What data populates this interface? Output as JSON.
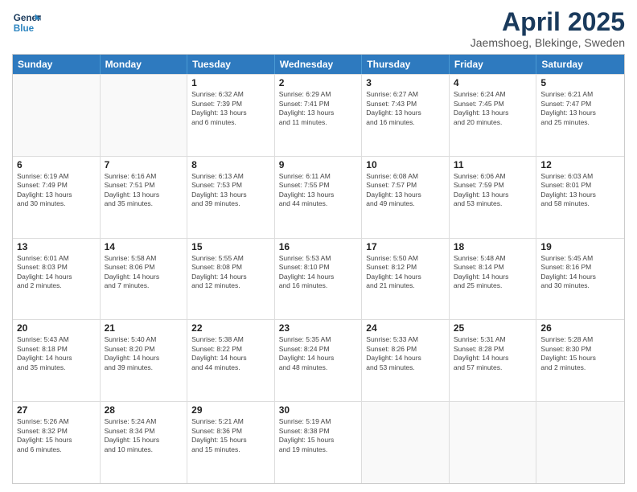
{
  "header": {
    "logo_line1": "General",
    "logo_line2": "Blue",
    "main_title": "April 2025",
    "subtitle": "Jaemshoeg, Blekinge, Sweden"
  },
  "calendar": {
    "days_of_week": [
      "Sunday",
      "Monday",
      "Tuesday",
      "Wednesday",
      "Thursday",
      "Friday",
      "Saturday"
    ],
    "rows": [
      [
        {
          "day": "",
          "empty": true,
          "lines": []
        },
        {
          "day": "",
          "empty": true,
          "lines": []
        },
        {
          "day": "1",
          "empty": false,
          "lines": [
            "Sunrise: 6:32 AM",
            "Sunset: 7:39 PM",
            "Daylight: 13 hours",
            "and 6 minutes."
          ]
        },
        {
          "day": "2",
          "empty": false,
          "lines": [
            "Sunrise: 6:29 AM",
            "Sunset: 7:41 PM",
            "Daylight: 13 hours",
            "and 11 minutes."
          ]
        },
        {
          "day": "3",
          "empty": false,
          "lines": [
            "Sunrise: 6:27 AM",
            "Sunset: 7:43 PM",
            "Daylight: 13 hours",
            "and 16 minutes."
          ]
        },
        {
          "day": "4",
          "empty": false,
          "lines": [
            "Sunrise: 6:24 AM",
            "Sunset: 7:45 PM",
            "Daylight: 13 hours",
            "and 20 minutes."
          ]
        },
        {
          "day": "5",
          "empty": false,
          "lines": [
            "Sunrise: 6:21 AM",
            "Sunset: 7:47 PM",
            "Daylight: 13 hours",
            "and 25 minutes."
          ]
        }
      ],
      [
        {
          "day": "6",
          "empty": false,
          "lines": [
            "Sunrise: 6:19 AM",
            "Sunset: 7:49 PM",
            "Daylight: 13 hours",
            "and 30 minutes."
          ]
        },
        {
          "day": "7",
          "empty": false,
          "lines": [
            "Sunrise: 6:16 AM",
            "Sunset: 7:51 PM",
            "Daylight: 13 hours",
            "and 35 minutes."
          ]
        },
        {
          "day": "8",
          "empty": false,
          "lines": [
            "Sunrise: 6:13 AM",
            "Sunset: 7:53 PM",
            "Daylight: 13 hours",
            "and 39 minutes."
          ]
        },
        {
          "day": "9",
          "empty": false,
          "lines": [
            "Sunrise: 6:11 AM",
            "Sunset: 7:55 PM",
            "Daylight: 13 hours",
            "and 44 minutes."
          ]
        },
        {
          "day": "10",
          "empty": false,
          "lines": [
            "Sunrise: 6:08 AM",
            "Sunset: 7:57 PM",
            "Daylight: 13 hours",
            "and 49 minutes."
          ]
        },
        {
          "day": "11",
          "empty": false,
          "lines": [
            "Sunrise: 6:06 AM",
            "Sunset: 7:59 PM",
            "Daylight: 13 hours",
            "and 53 minutes."
          ]
        },
        {
          "day": "12",
          "empty": false,
          "lines": [
            "Sunrise: 6:03 AM",
            "Sunset: 8:01 PM",
            "Daylight: 13 hours",
            "and 58 minutes."
          ]
        }
      ],
      [
        {
          "day": "13",
          "empty": false,
          "lines": [
            "Sunrise: 6:01 AM",
            "Sunset: 8:03 PM",
            "Daylight: 14 hours",
            "and 2 minutes."
          ]
        },
        {
          "day": "14",
          "empty": false,
          "lines": [
            "Sunrise: 5:58 AM",
            "Sunset: 8:06 PM",
            "Daylight: 14 hours",
            "and 7 minutes."
          ]
        },
        {
          "day": "15",
          "empty": false,
          "lines": [
            "Sunrise: 5:55 AM",
            "Sunset: 8:08 PM",
            "Daylight: 14 hours",
            "and 12 minutes."
          ]
        },
        {
          "day": "16",
          "empty": false,
          "lines": [
            "Sunrise: 5:53 AM",
            "Sunset: 8:10 PM",
            "Daylight: 14 hours",
            "and 16 minutes."
          ]
        },
        {
          "day": "17",
          "empty": false,
          "lines": [
            "Sunrise: 5:50 AM",
            "Sunset: 8:12 PM",
            "Daylight: 14 hours",
            "and 21 minutes."
          ]
        },
        {
          "day": "18",
          "empty": false,
          "lines": [
            "Sunrise: 5:48 AM",
            "Sunset: 8:14 PM",
            "Daylight: 14 hours",
            "and 25 minutes."
          ]
        },
        {
          "day": "19",
          "empty": false,
          "lines": [
            "Sunrise: 5:45 AM",
            "Sunset: 8:16 PM",
            "Daylight: 14 hours",
            "and 30 minutes."
          ]
        }
      ],
      [
        {
          "day": "20",
          "empty": false,
          "lines": [
            "Sunrise: 5:43 AM",
            "Sunset: 8:18 PM",
            "Daylight: 14 hours",
            "and 35 minutes."
          ]
        },
        {
          "day": "21",
          "empty": false,
          "lines": [
            "Sunrise: 5:40 AM",
            "Sunset: 8:20 PM",
            "Daylight: 14 hours",
            "and 39 minutes."
          ]
        },
        {
          "day": "22",
          "empty": false,
          "lines": [
            "Sunrise: 5:38 AM",
            "Sunset: 8:22 PM",
            "Daylight: 14 hours",
            "and 44 minutes."
          ]
        },
        {
          "day": "23",
          "empty": false,
          "lines": [
            "Sunrise: 5:35 AM",
            "Sunset: 8:24 PM",
            "Daylight: 14 hours",
            "and 48 minutes."
          ]
        },
        {
          "day": "24",
          "empty": false,
          "lines": [
            "Sunrise: 5:33 AM",
            "Sunset: 8:26 PM",
            "Daylight: 14 hours",
            "and 53 minutes."
          ]
        },
        {
          "day": "25",
          "empty": false,
          "lines": [
            "Sunrise: 5:31 AM",
            "Sunset: 8:28 PM",
            "Daylight: 14 hours",
            "and 57 minutes."
          ]
        },
        {
          "day": "26",
          "empty": false,
          "lines": [
            "Sunrise: 5:28 AM",
            "Sunset: 8:30 PM",
            "Daylight: 15 hours",
            "and 2 minutes."
          ]
        }
      ],
      [
        {
          "day": "27",
          "empty": false,
          "lines": [
            "Sunrise: 5:26 AM",
            "Sunset: 8:32 PM",
            "Daylight: 15 hours",
            "and 6 minutes."
          ]
        },
        {
          "day": "28",
          "empty": false,
          "lines": [
            "Sunrise: 5:24 AM",
            "Sunset: 8:34 PM",
            "Daylight: 15 hours",
            "and 10 minutes."
          ]
        },
        {
          "day": "29",
          "empty": false,
          "lines": [
            "Sunrise: 5:21 AM",
            "Sunset: 8:36 PM",
            "Daylight: 15 hours",
            "and 15 minutes."
          ]
        },
        {
          "day": "30",
          "empty": false,
          "lines": [
            "Sunrise: 5:19 AM",
            "Sunset: 8:38 PM",
            "Daylight: 15 hours",
            "and 19 minutes."
          ]
        },
        {
          "day": "",
          "empty": true,
          "lines": []
        },
        {
          "day": "",
          "empty": true,
          "lines": []
        },
        {
          "day": "",
          "empty": true,
          "lines": []
        }
      ]
    ]
  }
}
